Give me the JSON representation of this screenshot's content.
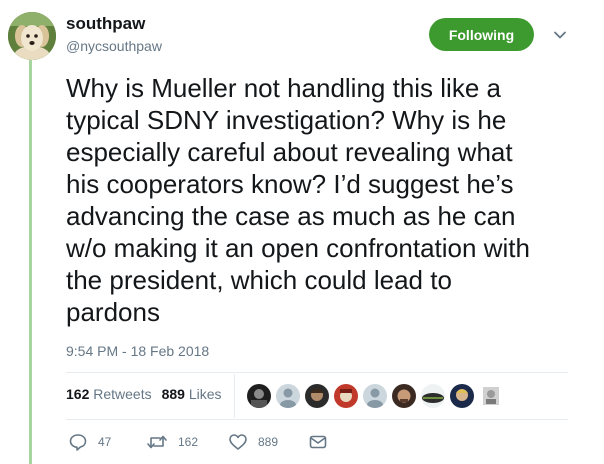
{
  "user": {
    "display_name": "southpaw",
    "handle": "@nycsouthpaw",
    "avatar_icon": "puppy-avatar"
  },
  "follow_button": {
    "label": "Following",
    "color": "#3d9a2e"
  },
  "menu_icon": "chevron-down-icon",
  "tweet": {
    "text": "Why is Mueller not handling this like a\ntypical SDNY investigation? Why is he\nespecially careful about revealing what\nhis cooperators know? I’d suggest he’s\nadvancing the case as much as he can\nw/o making it an open confrontation with\nthe president, which could lead to\npardons",
    "timestamp": "9:54 PM - 18 Feb 2018"
  },
  "stats": {
    "retweets_count": "162",
    "retweets_label": "Retweets",
    "likes_count": "889",
    "likes_label": "Likes"
  },
  "liker_avatars": [
    "liker-avatar-1",
    "liker-avatar-2",
    "liker-avatar-3",
    "liker-avatar-4",
    "liker-avatar-5",
    "liker-avatar-6",
    "liker-avatar-7",
    "liker-avatar-8",
    "liker-avatar-9"
  ],
  "actions": {
    "reply_count": "47",
    "retweet_count": "162",
    "like_count": "889"
  },
  "colors": {
    "thread_line": "#a7d5a0",
    "text_secondary": "#657786",
    "text_primary": "#14171a"
  }
}
